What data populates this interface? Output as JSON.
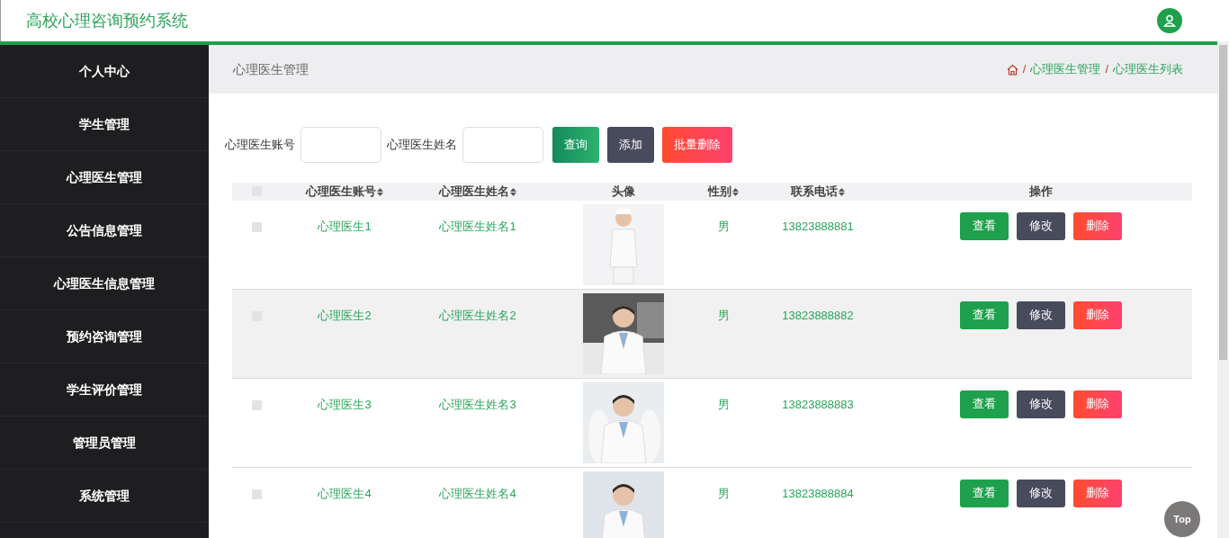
{
  "header": {
    "title": "高校心理咨询预约系统"
  },
  "sidebar": {
    "items": [
      {
        "label": "个人中心"
      },
      {
        "label": "学生管理"
      },
      {
        "label": "心理医生管理"
      },
      {
        "label": "公告信息管理"
      },
      {
        "label": "心理医生信息管理"
      },
      {
        "label": "预约咨询管理"
      },
      {
        "label": "学生评价管理"
      },
      {
        "label": "管理员管理"
      },
      {
        "label": "系统管理"
      }
    ]
  },
  "page_title": "心理医生管理",
  "breadcrumb": [
    {
      "separator": "/",
      "label": "心理医生管理"
    },
    {
      "separator": "/",
      "label": "心理医生列表"
    }
  ],
  "search": {
    "fields": [
      {
        "label": "心理医生账号"
      },
      {
        "label": "心理医生姓名"
      }
    ],
    "buttons": [
      {
        "label": "查询",
        "kind": "query"
      },
      {
        "label": "添加",
        "kind": "add"
      },
      {
        "label": "批量删除",
        "kind": "delete"
      }
    ]
  },
  "table": {
    "select_all": {
      "checked": false
    },
    "columns": [
      {
        "label": "心理医生账号",
        "sortable": true
      },
      {
        "label": "心理医生姓名",
        "sortable": true
      },
      {
        "label": "头像",
        "sortable": false
      },
      {
        "label": "性别",
        "sortable": true
      },
      {
        "label": "联系电话",
        "sortable": true
      },
      {
        "label": "操作",
        "sortable": false
      }
    ],
    "rows": [
      {
        "checked": false,
        "highlighted": false,
        "account": "心理医生1",
        "name": "心理医生姓名1",
        "avatar": {
          "kind": "picture"
        },
        "gender": "男",
        "phone": "13823888881",
        "actions": [
          {
            "label": "查看",
            "kind": "view"
          },
          {
            "label": "修改",
            "kind": "edit"
          },
          {
            "label": "删除",
            "kind": "delete"
          }
        ]
      },
      {
        "checked": false,
        "highlighted": true,
        "account": "心理医生2",
        "name": "心理医生姓名2",
        "avatar": {
          "kind": "picture"
        },
        "gender": "男",
        "phone": "13823888882",
        "actions": [
          {
            "label": "查看",
            "kind": "view"
          },
          {
            "label": "修改",
            "kind": "edit"
          },
          {
            "label": "删除",
            "kind": "delete"
          }
        ]
      },
      {
        "checked": false,
        "highlighted": false,
        "account": "心理医生3",
        "name": "心理医生姓名3",
        "avatar": {
          "kind": "picture"
        },
        "gender": "男",
        "phone": "13823888883",
        "actions": [
          {
            "label": "查看",
            "kind": "view"
          },
          {
            "label": "修改",
            "kind": "edit"
          },
          {
            "label": "删除",
            "kind": "delete"
          }
        ]
      },
      {
        "checked": false,
        "highlighted": false,
        "account": "心理医生4",
        "name": "心理医生姓名4",
        "avatar": {
          "kind": "picture"
        },
        "gender": "男",
        "phone": "13823888884",
        "actions": [
          {
            "label": "查看",
            "kind": "view"
          },
          {
            "label": "修改",
            "kind": "edit"
          },
          {
            "label": "删除",
            "kind": "delete"
          }
        ]
      }
    ]
  },
  "back_to_top": "Top"
}
